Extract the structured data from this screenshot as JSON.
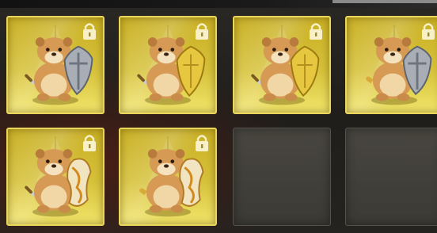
{
  "inventory": {
    "rows": [
      [
        {
          "status": "owned",
          "locked": true,
          "shield": "steel",
          "weapon": "sword"
        },
        {
          "status": "owned",
          "locked": true,
          "shield": "gold",
          "weapon": "sword"
        },
        {
          "status": "owned",
          "locked": true,
          "shield": "gold",
          "weapon": "sword"
        },
        {
          "status": "owned",
          "locked": true,
          "shield": "steel",
          "weapon": "ornate-sword"
        }
      ],
      [
        {
          "status": "owned",
          "locked": true,
          "shield": "flame",
          "weapon": "sword"
        },
        {
          "status": "owned",
          "locked": true,
          "shield": "flame",
          "weapon": "ornate-sword"
        },
        {
          "status": "empty"
        },
        {
          "status": "empty"
        }
      ]
    ]
  },
  "colors": {
    "tile_gold": "#d6c13a",
    "tile_border": "#e9d65a",
    "empty_slot": "#48463f",
    "lock_icon": "#f8f0c8",
    "background": "#24221f"
  },
  "icons": {
    "lock": "lock-icon",
    "character": "otter-knight-icon",
    "emblem": "triangle-emblem-icon"
  }
}
